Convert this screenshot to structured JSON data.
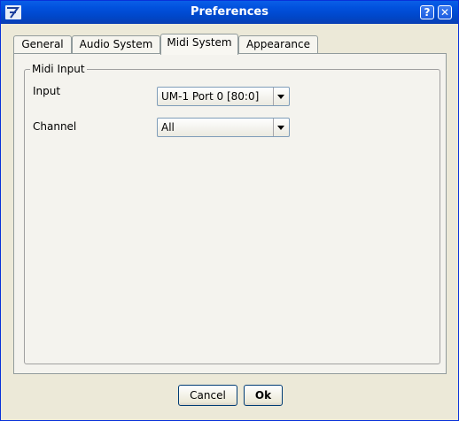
{
  "window": {
    "title": "Preferences",
    "help_label": "?",
    "close_label": "✕"
  },
  "tabs": [
    {
      "label": "General",
      "active": false
    },
    {
      "label": "Audio System",
      "active": false
    },
    {
      "label": "Midi System",
      "active": true
    },
    {
      "label": "Appearance",
      "active": false
    }
  ],
  "midi_input": {
    "group_title": "Midi Input",
    "input": {
      "label": "Input",
      "value": "UM-1 Port 0 [80:0]"
    },
    "channel": {
      "label": "Channel",
      "value": "All"
    }
  },
  "buttons": {
    "cancel": "Cancel",
    "ok": "Ok"
  },
  "colors": {
    "titlebar": "#0151dd",
    "panel": "#f4f3ee",
    "window": "#ece9d8",
    "combo_border": "#7f9db9"
  },
  "icons": {
    "app": "app-logo-icon",
    "dropdown": "chevron-down-icon"
  }
}
